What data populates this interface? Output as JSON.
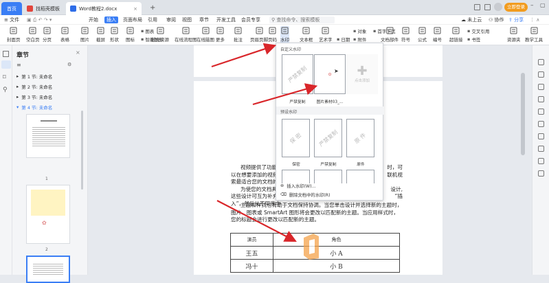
{
  "tabs": {
    "home": "首页",
    "template": "找稻壳模板",
    "doc": "Word教程2.docx",
    "new_tab": "+"
  },
  "topright": {
    "login": "立即登录"
  },
  "menu": {
    "file": "文件",
    "items": [
      "开始",
      "插入",
      "页面布局",
      "引用",
      "审阅",
      "视图",
      "章节",
      "开发工具",
      "会员专享"
    ],
    "active": "插入",
    "search": "查找命令、搜索模板",
    "cloud": "未上云",
    "collab": "协作",
    "share": "分享"
  },
  "ribbon": {
    "cover": "封面页",
    "blank": "空白页",
    "page_break": "分页",
    "table": "表格",
    "picture": "图片",
    "screenshot": "截屏",
    "shapes": "形状",
    "icons": "图标",
    "chart": "图表",
    "smart_graphic": "智能图形",
    "stock": "稻壳资源",
    "flowchart": "在线流程图",
    "mindmap": "在线脑图",
    "more": "更多",
    "comment": "批注",
    "header_footer": "页眉页脚",
    "page_num": "页码",
    "watermark": "水印",
    "textbox": "文本框",
    "wordart": "艺术字",
    "object": "对象",
    "dropcap": "首字下沉",
    "date": "日期",
    "attachment": "附件",
    "doc_parts": "文档部件",
    "symbol": "符号",
    "formula": "公式",
    "number": "编号",
    "hyperlink": "超链接",
    "crossref": "交叉引用",
    "bookmark": "书签",
    "resource": "资源夹",
    "teaching": "教学工具"
  },
  "sidebar": {
    "title": "章节",
    "sections": [
      "第 1 节: 未命名",
      "第 2 节: 未命名",
      "第 3 节: 未命名",
      "第 4 节: 未命名"
    ],
    "page_numbers": [
      "1",
      "2"
    ]
  },
  "document": {
    "para1": [
      "视频提供了功能强",
      "时，可",
      "以在想要添加的视频的",
      "联机视",
      "索最适合您的文档的视"
    ],
    "para2": [
      "为使您的文档具有",
      "设计,",
      "这些设计可互为补充。",
      "“插",
      "入”，然后从不同库中"
    ],
    "para3": "主题和样式也有助于文档保持协调。当您单击设计并选择新的主题时，图片、图表或 SmartArt 图形将会更改以匹配新的主题。当应用样式时，您的标题会进行更改以匹配新的主题。",
    "table": {
      "headers": [
        "演员",
        "角色"
      ],
      "rows": [
        [
          "王五",
          "小 A"
        ],
        [
          "冯十",
          "小 B"
        ]
      ]
    }
  },
  "watermark_popup": {
    "custom_label": "自定义水印",
    "custom": [
      {
        "text": "严禁复制",
        "label": "严禁复制"
      },
      {
        "text": "",
        "label": "图片素材03_..."
      }
    ],
    "add_label": "点击添加",
    "preset_label": "预设水印",
    "preset": [
      {
        "text": "保 密",
        "label": "保密"
      },
      {
        "text": "严禁复制",
        "label": "严禁复制"
      },
      {
        "text": "原 件",
        "label": "原件"
      }
    ],
    "insert": "插入水印(W)...",
    "delete": "删除文档中的水印(R)"
  },
  "colors": {
    "accent": "#3a7ef5",
    "arrow": "#d9262a"
  }
}
